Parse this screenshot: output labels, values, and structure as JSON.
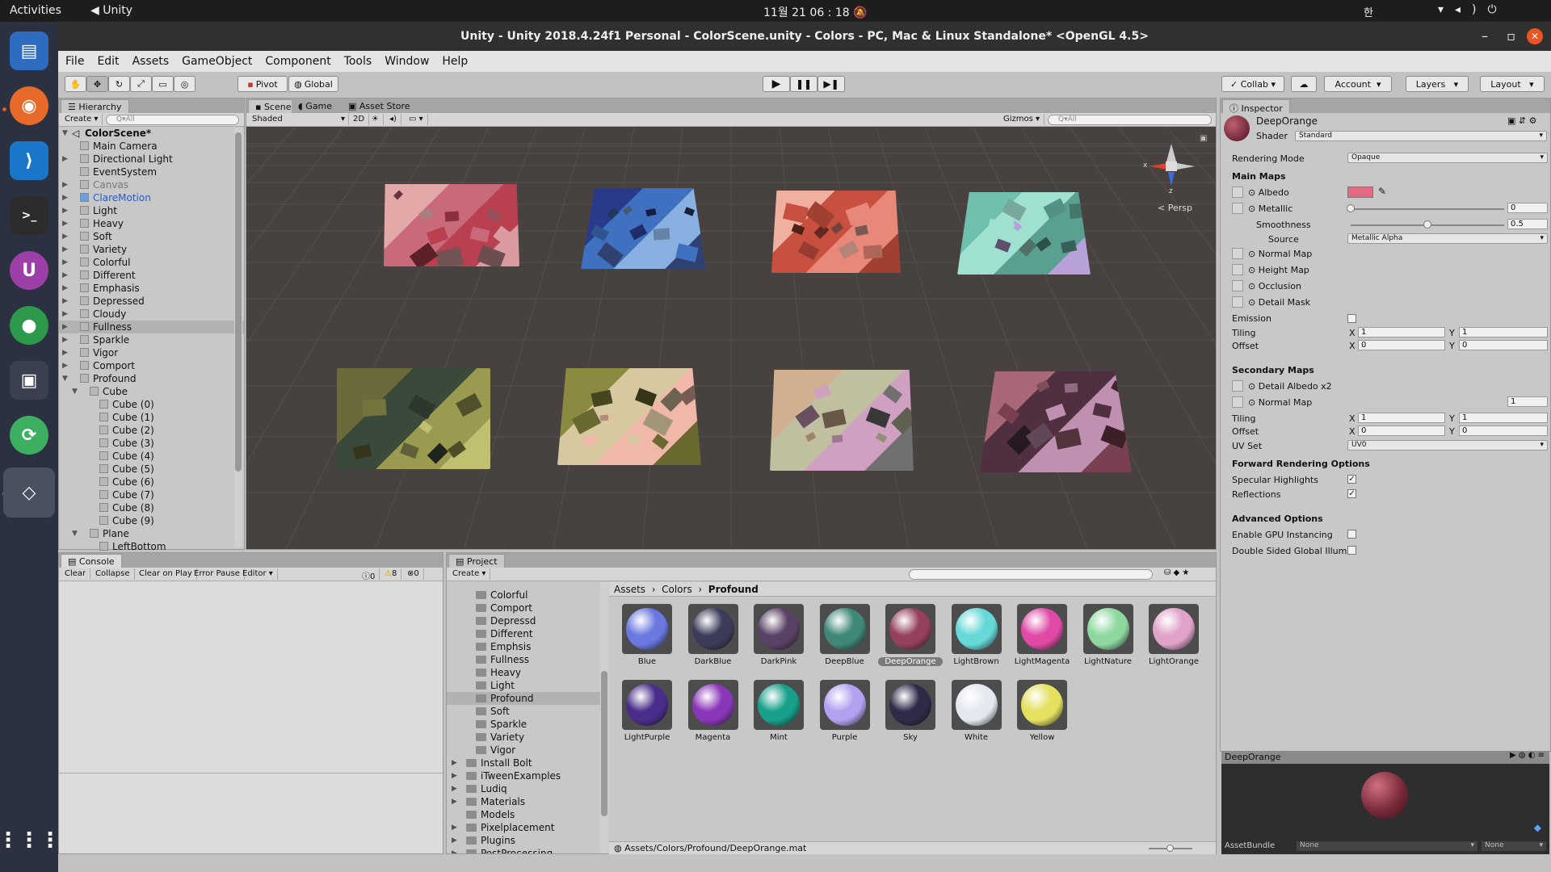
{
  "top_bar": {
    "activities": "Activities",
    "app": "Unity",
    "clock": "11월 21  06 : 18",
    "ime": "한"
  },
  "dock": {
    "icons": [
      "files-icon",
      "firefox-icon",
      "vscode-icon",
      "terminal-icon",
      "ubuntu-software-icon",
      "chrome-icon",
      "screenshot-icon",
      "updater-icon",
      "unity-icon",
      "apps-grid-icon"
    ]
  },
  "window": {
    "title": "Unity - Unity 2018.4.24f1 Personal - ColorScene.unity - Colors - PC, Mac & Linux Standalone* <OpenGL 4.5>"
  },
  "menu": [
    "File",
    "Edit",
    "Assets",
    "GameObject",
    "Component",
    "Tools",
    "Window",
    "Help"
  ],
  "toolbar": {
    "pivot": "Pivot",
    "global": "Global",
    "collab": "Collab",
    "account": "Account",
    "layers": "Layers",
    "layout": "Layout"
  },
  "hierarchy": {
    "tab": "Hierarchy",
    "create": "Create",
    "search_placeholder": "Q▾All",
    "scene": "ColorScene*",
    "items": [
      {
        "label": "Main Camera",
        "depth": 1,
        "arrow": ""
      },
      {
        "label": "Directional Light",
        "depth": 1,
        "arrow": "▶"
      },
      {
        "label": "EventSystem",
        "depth": 1,
        "arrow": ""
      },
      {
        "label": "Canvas",
        "depth": 1,
        "arrow": "▶",
        "dim": true
      },
      {
        "label": "ClareMotion",
        "depth": 1,
        "arrow": "▶",
        "blue": true
      },
      {
        "label": "Light",
        "depth": 1,
        "arrow": "▶"
      },
      {
        "label": "Heavy",
        "depth": 1,
        "arrow": "▶"
      },
      {
        "label": "Soft",
        "depth": 1,
        "arrow": "▶"
      },
      {
        "label": "Variety",
        "depth": 1,
        "arrow": "▶"
      },
      {
        "label": "Colorful",
        "depth": 1,
        "arrow": "▶"
      },
      {
        "label": "Different",
        "depth": 1,
        "arrow": "▶"
      },
      {
        "label": "Emphasis",
        "depth": 1,
        "arrow": "▶"
      },
      {
        "label": "Depressed",
        "depth": 1,
        "arrow": "▶"
      },
      {
        "label": "Cloudy",
        "depth": 1,
        "arrow": "▶"
      },
      {
        "label": "Fullness",
        "depth": 1,
        "arrow": "▶",
        "sel": true
      },
      {
        "label": "Sparkle",
        "depth": 1,
        "arrow": "▶"
      },
      {
        "label": "Vigor",
        "depth": 1,
        "arrow": "▶"
      },
      {
        "label": "Comport",
        "depth": 1,
        "arrow": "▶"
      },
      {
        "label": "Profound",
        "depth": 1,
        "arrow": "▼"
      },
      {
        "label": "Cube",
        "depth": 2,
        "arrow": "▼"
      },
      {
        "label": "Cube (0)",
        "depth": 3,
        "arrow": ""
      },
      {
        "label": "Cube (1)",
        "depth": 3,
        "arrow": ""
      },
      {
        "label": "Cube (2)",
        "depth": 3,
        "arrow": ""
      },
      {
        "label": "Cube (3)",
        "depth": 3,
        "arrow": ""
      },
      {
        "label": "Cube (4)",
        "depth": 3,
        "arrow": ""
      },
      {
        "label": "Cube (5)",
        "depth": 3,
        "arrow": ""
      },
      {
        "label": "Cube (6)",
        "depth": 3,
        "arrow": ""
      },
      {
        "label": "Cube (7)",
        "depth": 3,
        "arrow": ""
      },
      {
        "label": "Cube (8)",
        "depth": 3,
        "arrow": ""
      },
      {
        "label": "Cube (9)",
        "depth": 3,
        "arrow": ""
      },
      {
        "label": "Plane",
        "depth": 2,
        "arrow": "▼"
      },
      {
        "label": "LeftBottom",
        "depth": 3,
        "arrow": ""
      }
    ]
  },
  "scene": {
    "tabs": [
      "Scene",
      "Game",
      "Asset Store"
    ],
    "shading": "Shaded",
    "mode2d": "2D",
    "gizmos": "Gizmos",
    "search_placeholder": "Q▾All",
    "persp": "< Persp",
    "axis_x": "x",
    "axis_z": "z",
    "boards": [
      {
        "colors": [
          "#e3a8a8",
          "#c86a7a",
          "#b84050",
          "#d99aa0"
        ]
      },
      {
        "colors": [
          "#2a3a8a",
          "#4070c0",
          "#88b0e0",
          "#304070"
        ]
      },
      {
        "colors": [
          "#f0b0a0",
          "#c85040",
          "#e88878",
          "#a04030"
        ]
      },
      {
        "colors": [
          "#70c0b0",
          "#a0e0d0",
          "#5aa090",
          "#b8a0d8"
        ]
      },
      {
        "colors": [
          "#6a6a3a",
          "#3a4a3a",
          "#9a9a50",
          "#c0c070"
        ]
      },
      {
        "colors": [
          "#8a8a40",
          "#d8c8a0",
          "#f0b8a8",
          "#6a6a30"
        ]
      },
      {
        "colors": [
          "#d0b090",
          "#c0c0a0",
          "#d0a0c0",
          "#707070"
        ]
      },
      {
        "colors": [
          "#a86878",
          "#503040",
          "#c090b0",
          "#784050"
        ]
      }
    ]
  },
  "inspector": {
    "tab": "Inspector",
    "name": "DeepOrange",
    "shader_label": "Shader",
    "shader": "Standard",
    "rendering_mode_label": "Rendering Mode",
    "rendering_mode": "Opaque",
    "main_maps": "Main Maps",
    "albedo": "Albedo",
    "albedo_color": "#e46a80",
    "metallic": "Metallic",
    "metallic_value": "0",
    "metallic_level": 0,
    "smoothness": "Smoothness",
    "smoothness_value": "0.5",
    "smoothness_level": 0.5,
    "source_label": "Source",
    "source": "Metallic Alpha",
    "normal_map": "Normal Map",
    "height_map": "Height Map",
    "occlusion": "Occlusion",
    "detail_mask": "Detail Mask",
    "emission": "Emission",
    "tiling": "Tiling",
    "offset": "Offset",
    "x": "X",
    "y": "Y",
    "tiling_x": "1",
    "tiling_y": "1",
    "offset_x": "0",
    "offset_y": "0",
    "secondary_maps": "Secondary Maps",
    "detail_albedo": "Detail Albedo x2",
    "normal_map2": "Normal Map",
    "normal_scale": "1",
    "tiling2_x": "1",
    "tiling2_y": "1",
    "offset2_x": "0",
    "offset2_y": "0",
    "uv_set_label": "UV Set",
    "uv_set": "UV0",
    "forward": "Forward Rendering Options",
    "specular": "Specular Highlights",
    "reflections": "Reflections",
    "advanced": "Advanced Options",
    "gpu_instancing": "Enable GPU Instancing",
    "double_sided": "Double Sided Global Illumin",
    "preview_title": "DeepOrange",
    "asset_bundle_label": "AssetBundle",
    "asset_bundle": "None",
    "variant": "None"
  },
  "console": {
    "tab": "Console",
    "clear": "Clear",
    "collapse": "Collapse",
    "clear_on_play": "Clear on Play",
    "error_pause": "Error Pause",
    "editor": "Editor",
    "info_count": "0",
    "warn_count": "8",
    "error_count": "0"
  },
  "project": {
    "tab": "Project",
    "create": "Create",
    "folders": [
      {
        "label": "Colorful",
        "depth": 2,
        "arrow": ""
      },
      {
        "label": "Comport",
        "depth": 2,
        "arrow": ""
      },
      {
        "label": "Depressd",
        "depth": 2,
        "arrow": ""
      },
      {
        "label": "Different",
        "depth": 2,
        "arrow": ""
      },
      {
        "label": "Emphsis",
        "depth": 2,
        "arrow": ""
      },
      {
        "label": "Fullness",
        "depth": 2,
        "arrow": ""
      },
      {
        "label": "Heavy",
        "depth": 2,
        "arrow": ""
      },
      {
        "label": "Light",
        "depth": 2,
        "arrow": ""
      },
      {
        "label": "Profound",
        "depth": 2,
        "arrow": "",
        "sel": true
      },
      {
        "label": "Soft",
        "depth": 2,
        "arrow": ""
      },
      {
        "label": "Sparkle",
        "depth": 2,
        "arrow": ""
      },
      {
        "label": "Variety",
        "depth": 2,
        "arrow": ""
      },
      {
        "label": "Vigor",
        "depth": 2,
        "arrow": ""
      },
      {
        "label": "Install Bolt",
        "depth": 1,
        "arrow": "▶"
      },
      {
        "label": "iTweenExamples",
        "depth": 1,
        "arrow": "▶"
      },
      {
        "label": "Ludiq",
        "depth": 1,
        "arrow": "▶"
      },
      {
        "label": "Materials",
        "depth": 1,
        "arrow": "▶"
      },
      {
        "label": "Models",
        "depth": 1,
        "arrow": ""
      },
      {
        "label": "Pixelplacement",
        "depth": 1,
        "arrow": "▶"
      },
      {
        "label": "Plugins",
        "depth": 1,
        "arrow": "▶"
      },
      {
        "label": "PostProcessing",
        "depth": 1,
        "arrow": "▶"
      }
    ],
    "breadcrumb": [
      "Assets",
      "Colors",
      "Profound"
    ],
    "materials": [
      {
        "name": "Blue",
        "color": "#6a78e0"
      },
      {
        "name": "DarkBlue",
        "color": "#3c3c5a"
      },
      {
        "name": "DarkPink",
        "color": "#5a4266"
      },
      {
        "name": "DeepBlue",
        "color": "#3f8878"
      },
      {
        "name": "DeepOrange",
        "color": "#94405e",
        "sel": true
      },
      {
        "name": "LightBrown",
        "color": "#66d8d8"
      },
      {
        "name": "LightMagenta",
        "color": "#e04aa6"
      },
      {
        "name": "LightNature",
        "color": "#8ed8a0"
      },
      {
        "name": "LightOrange",
        "color": "#e0a2c8"
      },
      {
        "name": "LightPurple",
        "color": "#4a2c8a"
      },
      {
        "name": "Magenta",
        "color": "#8a36b8"
      },
      {
        "name": "Mint",
        "color": "#18a08a"
      },
      {
        "name": "Purple",
        "color": "#b4a0f0"
      },
      {
        "name": "Sky",
        "color": "#302a48"
      },
      {
        "name": "White",
        "color": "#e4e8f0"
      },
      {
        "name": "Yellow",
        "color": "#e4e060"
      }
    ],
    "status_path": "Assets/Colors/Profound/DeepOrange.mat"
  }
}
